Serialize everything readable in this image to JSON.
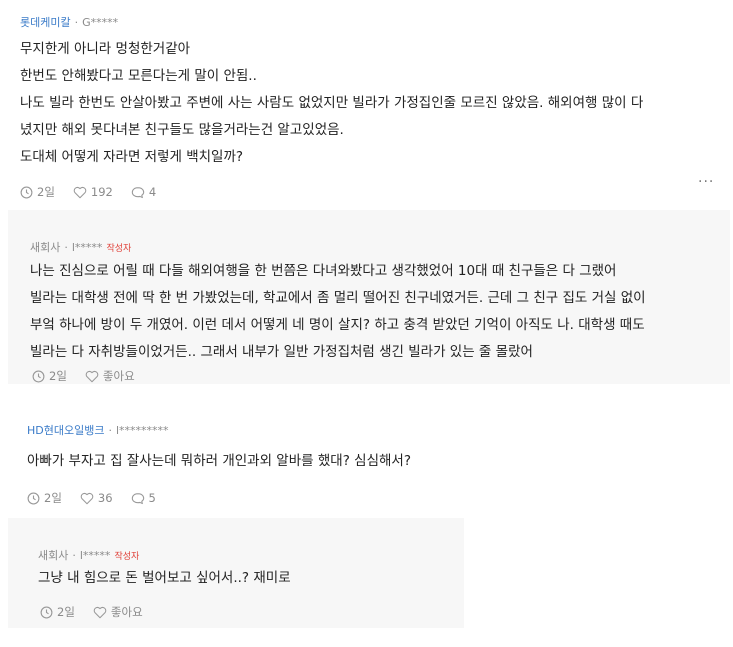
{
  "comments": [
    {
      "company": "롯데케미칼",
      "author": "G*****",
      "lines": [
        "무지한게 아니라 멍청한거같아",
        "한번도 안해봤다고 모른다는게 말이 안됨..",
        "나도 빌라 한번도 안살아봤고 주변에 사는 사람도 없었지만 빌라가 가정집인줄 모르진 않았음. 해외여행 많이 다",
        "녔지만 해외 못다녀본 친구들도 많을거라는건 알고있었음.",
        "도대체 어떻게 자라면 저렇게 백치일까?"
      ],
      "time": "2일",
      "likes": "192",
      "replies": "4",
      "more": "···"
    },
    {
      "company": "새회사",
      "author": "l*****",
      "badge": "작성자",
      "lines": [
        "나는 진심으로 어릴 때 다들 해외여행을 한 번쯤은 다녀와봤다고 생각했었어 10대 때 친구들은 다 그랬어",
        "빌라는 대학생 전에 딱 한 번 가봤었는데, 학교에서 좀 멀리 떨어진 친구네였거든. 근데 그 친구 집도 거실 없이",
        "부엌 하나에 방이 두 개였어. 이런 데서 어떻게 네 명이 살지? 하고 충격 받았던 기억이 아직도 나. 대학생 때도",
        "빌라는 다 자취방들이었거든.. 그래서 내부가 일반 가정집처럼 생긴 빌라가 있는 줄 몰랐어"
      ],
      "time": "2일",
      "like_label": "좋아요"
    },
    {
      "company": "HD현대오일뱅크",
      "author": "l*********",
      "lines": [
        "아빠가 부자고 집 잘사는데 뭐하러 개인과외 알바를 했대? 심심해서?"
      ],
      "time": "2일",
      "likes": "36",
      "replies": "5"
    },
    {
      "company": "새회사",
      "author": "l*****",
      "badge": "작성자",
      "lines": [
        "그냥 내 힘으로 돈 벌어보고 싶어서..? 재미로"
      ],
      "time": "2일",
      "like_label": "좋아요"
    }
  ]
}
